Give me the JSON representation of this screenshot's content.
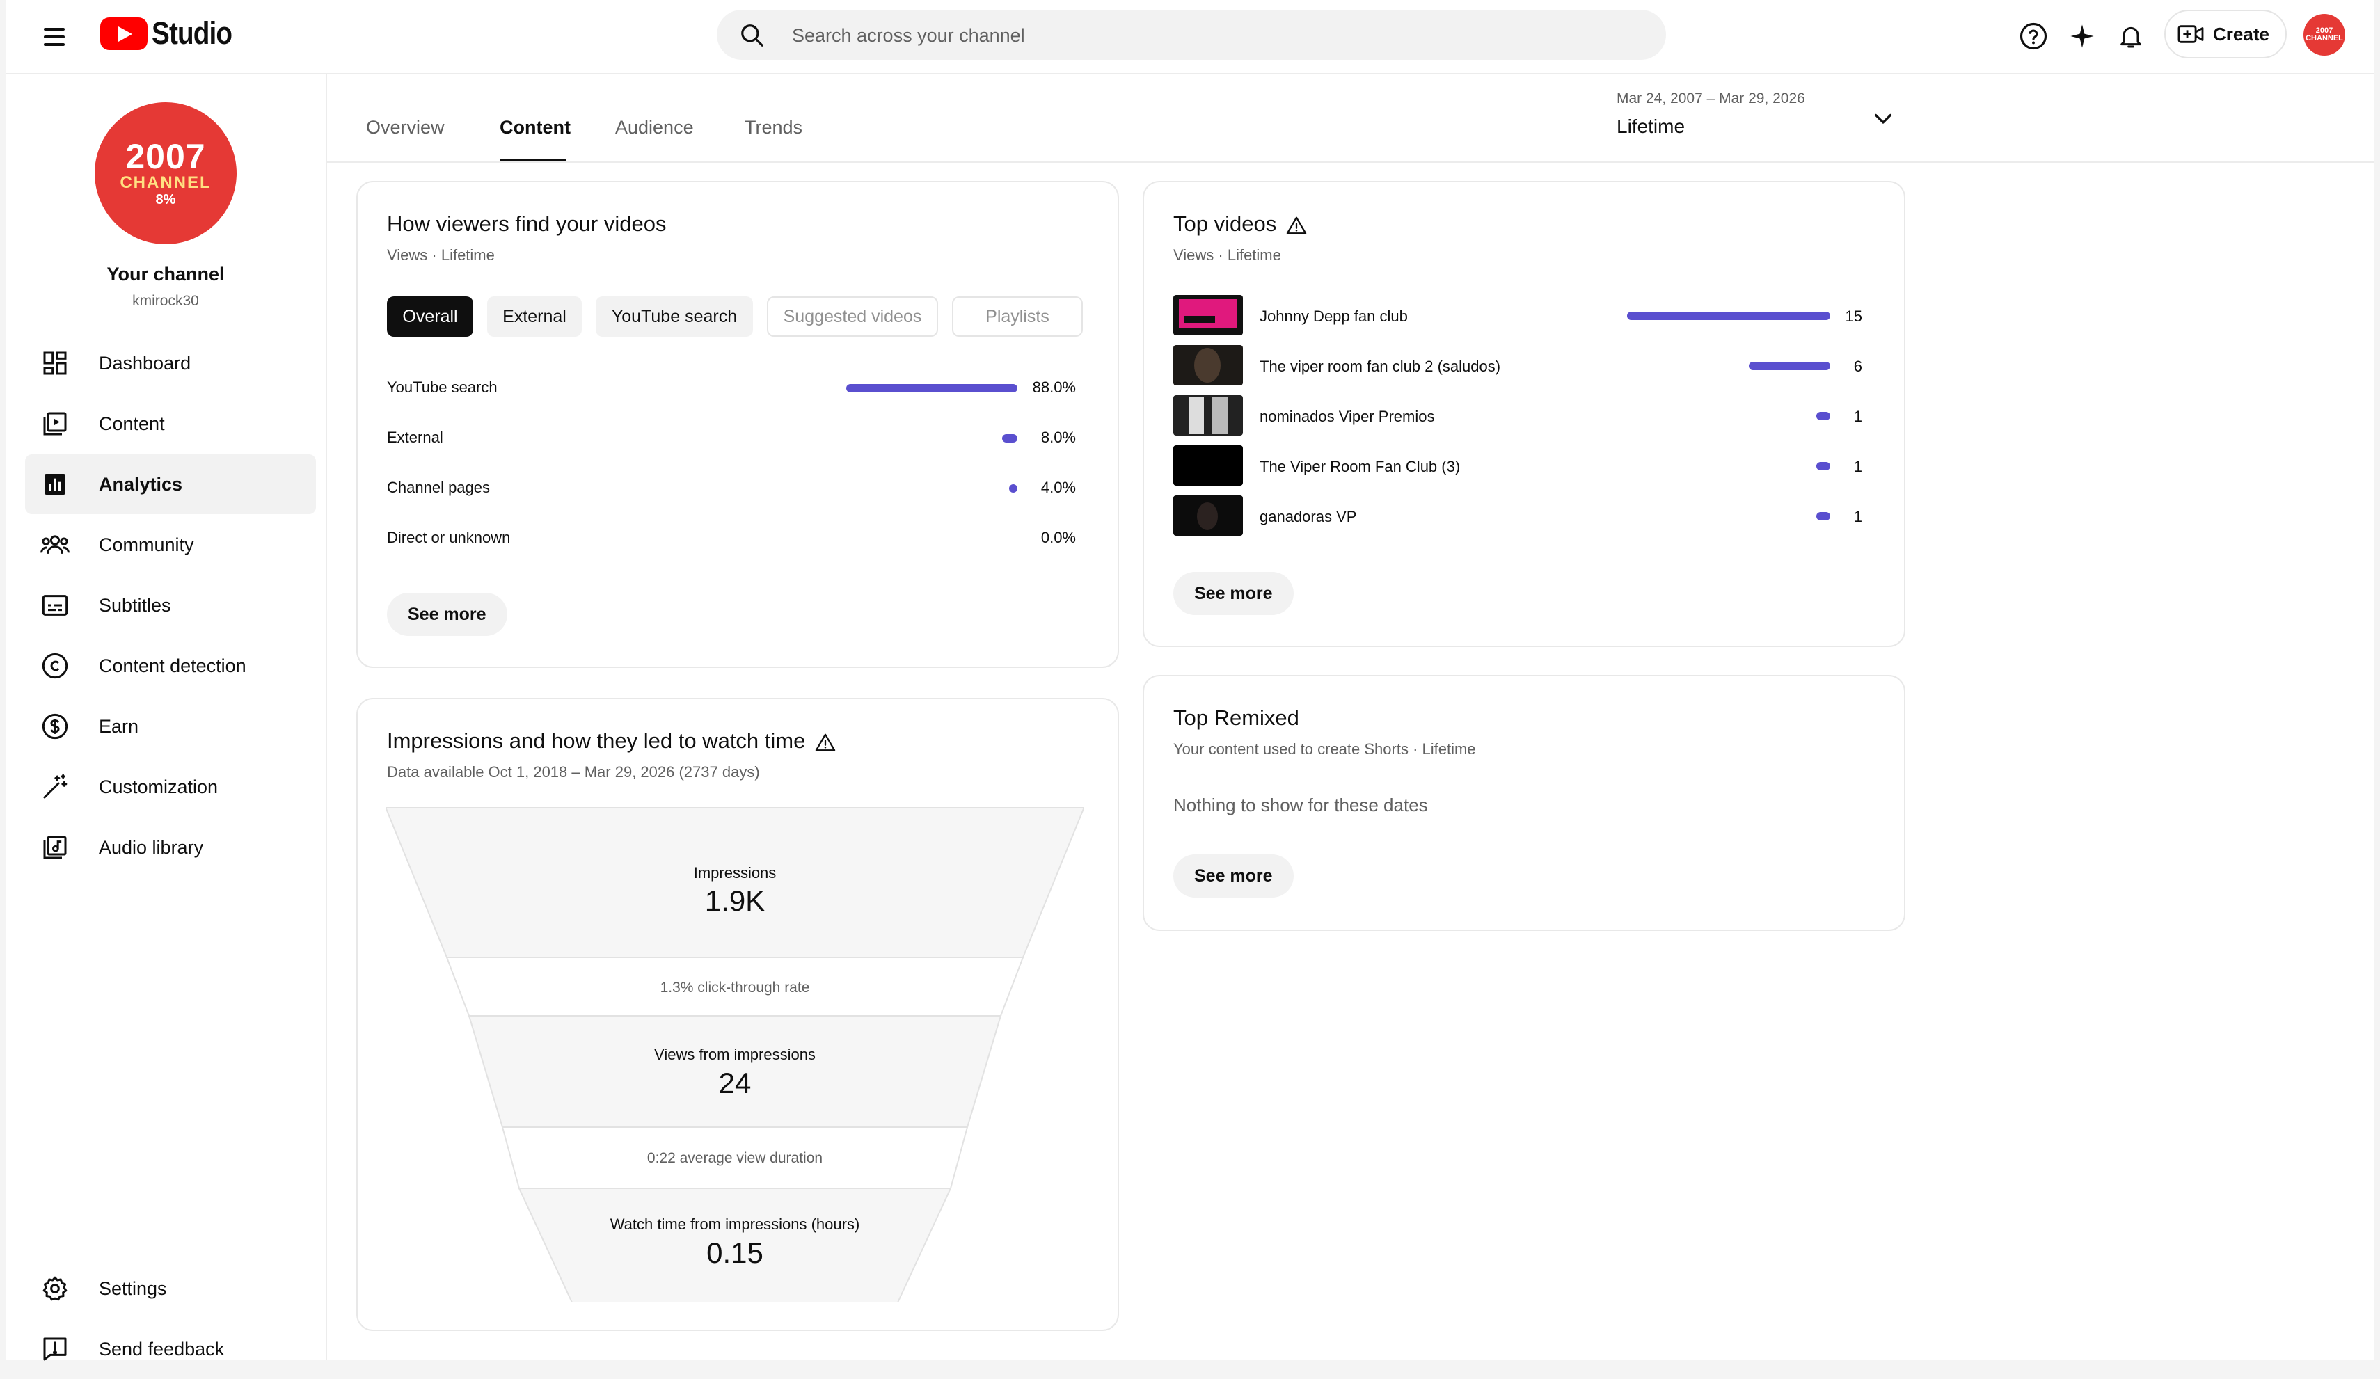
{
  "topbar": {
    "logo_text": "Studio",
    "search_placeholder": "Search across your channel",
    "create_label": "Create",
    "avatar_text": "2007 CHANNEL"
  },
  "sidebar": {
    "avatar": {
      "line1": "2007",
      "line2": "CHANNEL",
      "line3": "8%"
    },
    "channel_name": "Your channel",
    "channel_handle": "kmirock30",
    "items": [
      {
        "label": "Dashboard",
        "icon": "dashboard-icon"
      },
      {
        "label": "Content",
        "icon": "content-icon"
      },
      {
        "label": "Analytics",
        "icon": "analytics-icon",
        "active": true
      },
      {
        "label": "Community",
        "icon": "community-icon"
      },
      {
        "label": "Subtitles",
        "icon": "subtitles-icon"
      },
      {
        "label": "Content detection",
        "icon": "copyright-icon"
      },
      {
        "label": "Earn",
        "icon": "dollar-icon"
      },
      {
        "label": "Customization",
        "icon": "magic-wand-icon"
      },
      {
        "label": "Audio library",
        "icon": "audio-library-icon"
      }
    ],
    "bottom_items": [
      {
        "label": "Settings",
        "icon": "gear-icon"
      },
      {
        "label": "Send feedback",
        "icon": "feedback-icon"
      }
    ]
  },
  "tabs": [
    "Overview",
    "Content",
    "Audience",
    "Trends"
  ],
  "active_tab": "Content",
  "date": {
    "range": "Mar 24, 2007 – Mar 29, 2026",
    "label": "Lifetime"
  },
  "traffic": {
    "title": "How viewers find your videos",
    "subtitle": "Views · Lifetime",
    "chips": [
      "Overall",
      "External",
      "YouTube search",
      "Suggested videos",
      "Playlists"
    ],
    "rows": [
      {
        "name": "YouTube search",
        "value": "88.0%",
        "fraction": 0.88
      },
      {
        "name": "External",
        "value": "8.0%",
        "fraction": 0.08
      },
      {
        "name": "Channel pages",
        "value": "4.0%",
        "fraction": 0.04
      },
      {
        "name": "Direct or unknown",
        "value": "0.0%",
        "fraction": 0.0
      }
    ],
    "see_more": "See more"
  },
  "top_videos": {
    "title": "Top videos",
    "subtitle": "Views · Lifetime",
    "rows": [
      {
        "title": "Johnny Depp fan club",
        "views": "15",
        "fraction": 1.0
      },
      {
        "title": "The viper room fan club 2 (saludos)",
        "views": "6",
        "fraction": 0.4
      },
      {
        "title": "nominados Viper Premios",
        "views": "1",
        "fraction": 0.067
      },
      {
        "title": "The Viper Room Fan Club (3)",
        "views": "1",
        "fraction": 0.067
      },
      {
        "title": "ganadoras VP",
        "views": "1",
        "fraction": 0.067
      }
    ],
    "see_more": "See more"
  },
  "top_remixed": {
    "title": "Top Remixed",
    "subtitle": "Your content used to create Shorts · Lifetime",
    "empty_text": "Nothing to show for these dates",
    "see_more": "See more"
  },
  "impressions": {
    "title": "Impressions and how they led to watch time",
    "subtitle": "Data available Oct 1, 2018 – Mar 29, 2026 (2737 days)",
    "impressions_label": "Impressions",
    "impressions_value": "1.9K",
    "ctr_text": "1.3% click-through rate",
    "views_label": "Views from impressions",
    "views_value": "24",
    "avd_text": "0:22 average view duration",
    "watch_label": "Watch time from impressions (hours)",
    "watch_value": "0.15"
  },
  "colors": {
    "accent": "#5a4fcf",
    "brand_red": "#ff0000",
    "avatar_red": "#e53935"
  }
}
